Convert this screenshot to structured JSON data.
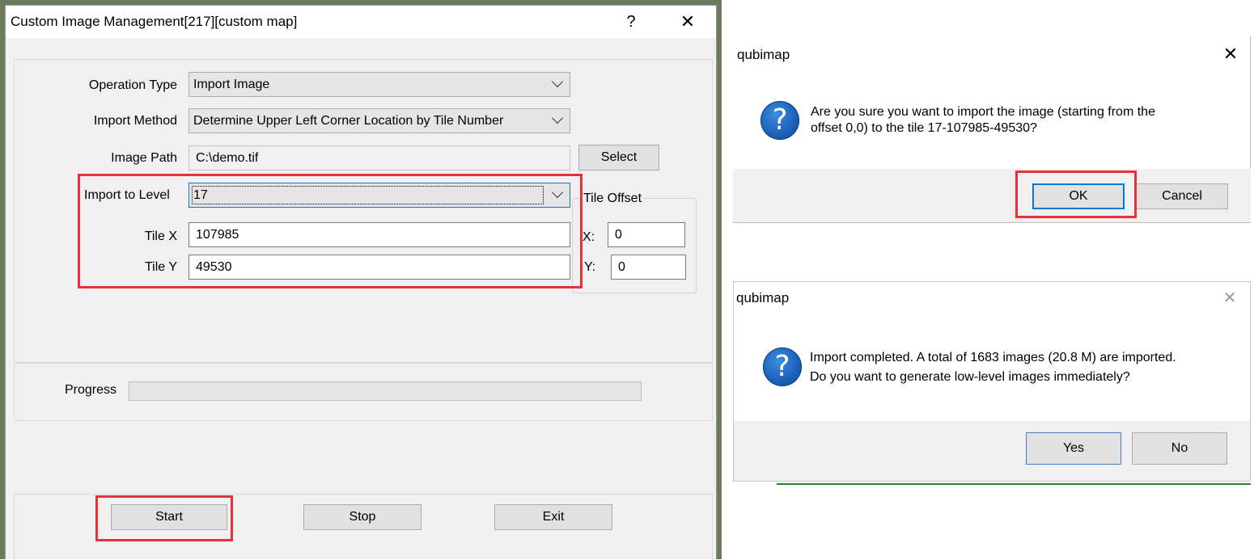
{
  "main_dialog": {
    "title": "Custom Image Management[217][custom map]",
    "help_glyph": "?",
    "close_glyph": "✕",
    "operation_type": {
      "label": "Operation Type",
      "value": "Import Image"
    },
    "import_method": {
      "label": "Import Method",
      "value": "Determine Upper Left Corner Location by Tile Number"
    },
    "image_path": {
      "label": "Image Path",
      "value": "C:\\demo.tif",
      "select_label": "Select"
    },
    "import_level": {
      "label": "Import to Level",
      "value": "17"
    },
    "tile_x": {
      "label": "Tile X",
      "value": "107985"
    },
    "tile_y": {
      "label": "Tile Y",
      "value": "49530"
    },
    "tile_offset": {
      "group_label": "Tile Offset",
      "x_label": "X:",
      "x_value": "0",
      "y_label": "Y:",
      "y_value": "0"
    },
    "progress_label": "Progress",
    "buttons": {
      "start": "Start",
      "stop": "Stop",
      "exit": "Exit"
    }
  },
  "confirm_dialog": {
    "title": "qubimap",
    "close_glyph": "✕",
    "icon": "question-icon",
    "message_line1": "Are you sure you want to import the image (starting from the",
    "message_line2": "offset 0,0) to the tile 17-107985-49530?",
    "ok": "OK",
    "cancel": "Cancel"
  },
  "complete_dialog": {
    "title": "qubimap",
    "close_glyph": "✕",
    "icon": "question-icon",
    "message_line1": "Import completed. A total of 1683 images (20.8 M) are imported.",
    "message_line2": "Do you want to generate low-level images immediately?",
    "yes": "Yes",
    "no": "No"
  },
  "colors": {
    "highlight": "#e8313a",
    "focus_blue": "#0078d7",
    "dialog_bg": "#f0f0f0"
  }
}
